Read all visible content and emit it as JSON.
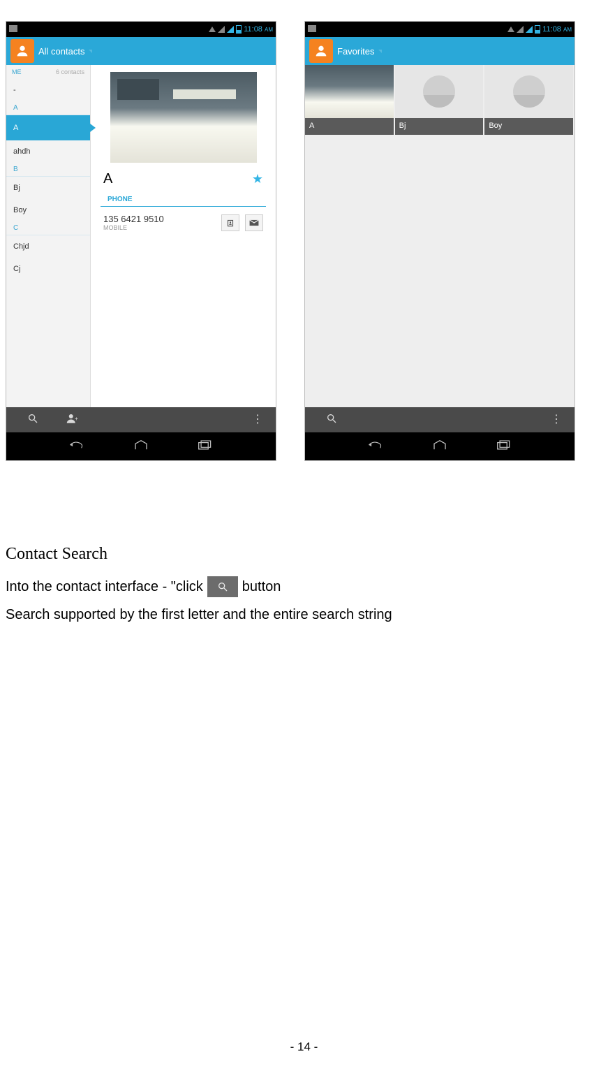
{
  "statusbar": {
    "time": "11:08",
    "ampm": "AM"
  },
  "left_phone": {
    "appbar_title": "All contacts",
    "me_label": "ME",
    "count_label": "6 contacts",
    "list": {
      "dash": "-",
      "letter_a": "A",
      "sel": "A",
      "ahdh": "ahdh",
      "letter_b": "B",
      "bj": "Bj",
      "boy": "Boy",
      "letter_c": "C",
      "chjd": "Chjd",
      "cj": "Cj"
    },
    "detail": {
      "name": "A",
      "section": "PHONE",
      "number": "135 6421 9510",
      "type": "MOBILE"
    }
  },
  "right_phone": {
    "appbar_title": "Favorites",
    "tiles": {
      "a": "A",
      "bj": "Bj",
      "boy": "Boy"
    }
  },
  "doc": {
    "heading": "Contact Search",
    "line1_a": "Into the contact interface - \"click",
    "line1_b": "button",
    "line2": "Search supported by the first letter and the entire search string",
    "page_no": "- 14 -"
  }
}
